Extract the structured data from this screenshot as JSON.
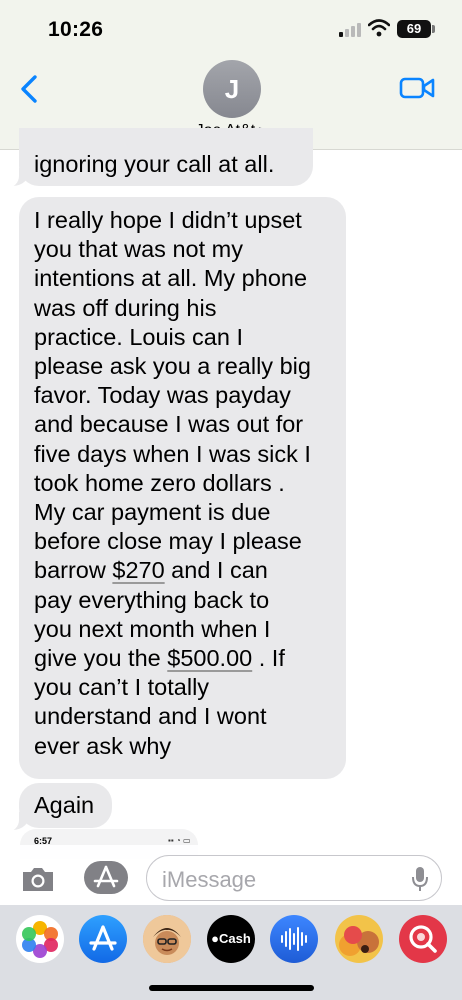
{
  "status_bar": {
    "time": "10:26",
    "battery": "69"
  },
  "header": {
    "avatar_initial": "J",
    "contact_name": "Joe At&t",
    "contact_chevron": ">"
  },
  "messages": [
    {
      "id": 1,
      "lines": [
        "ignoring your call at all."
      ]
    },
    {
      "id": 2,
      "lines": [
        "I really hope I didn’t upset",
        "you that was not my",
        "intentions at all. My phone",
        "was off during his",
        "practice. Louis can I",
        "please ask you a really big",
        "favor. Today was payday",
        "and because I was out for",
        "five days when I was sick I",
        "took home zero dollars .",
        "My car payment is due",
        "before close may I please",
        "barrow $270 and I can",
        "pay everything back to",
        "you next month when I",
        "give you the $500.00 . If",
        "you can’t I totally",
        "understand and I wont",
        "ever ask why"
      ]
    },
    {
      "id": 3,
      "lines": [
        "Again"
      ]
    }
  ],
  "amounts": [
    "$270",
    "$500.00"
  ],
  "partial_screenshot": {
    "time": "6:57"
  },
  "composer": {
    "placeholder": "iMessage"
  },
  "app_drawer": {
    "apps": [
      "photos-icon",
      "app-store-icon",
      "memoji-icon",
      "apple-cash-icon",
      "audio-message-icon",
      "memoji-stickers-icon",
      "images-search-icon"
    ],
    "cash_label": "Cash"
  },
  "colors": {
    "accent": "#0a84ff",
    "bubble": "#e9e9eb",
    "header_bg": "#f2f4ed"
  }
}
